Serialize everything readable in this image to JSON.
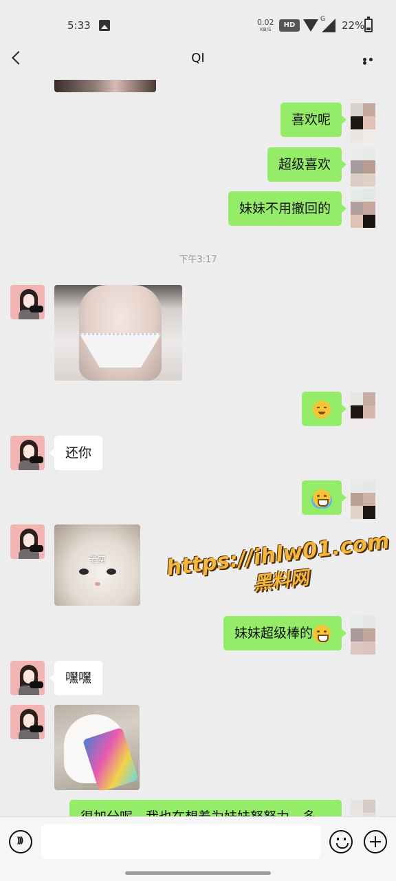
{
  "status_bar": {
    "time": "5:33",
    "net_speed_value": "0.02",
    "net_speed_unit": "KB/S",
    "hd_badge": "HD",
    "signal_label": "G",
    "battery": "22%"
  },
  "header": {
    "title": "QI"
  },
  "messages": {
    "m1": "喜欢呢",
    "m2": "超级喜欢",
    "m3": "妹妹不用撤回的",
    "divider": "下午3:17",
    "m4": "还你",
    "m5": "妹妹超级棒的",
    "m6": "嘿嘿",
    "m7": "很加分呢，我也在想着为妹妹努努力，多",
    "cat_caption": "老实"
  },
  "watermark": {
    "url": "https://ihlw01.com",
    "name": "黑料网"
  },
  "input": {
    "value": ""
  },
  "colors": {
    "self_bubble": "#95ec69",
    "other_bubble": "#ffffff",
    "background": "#ededed"
  }
}
